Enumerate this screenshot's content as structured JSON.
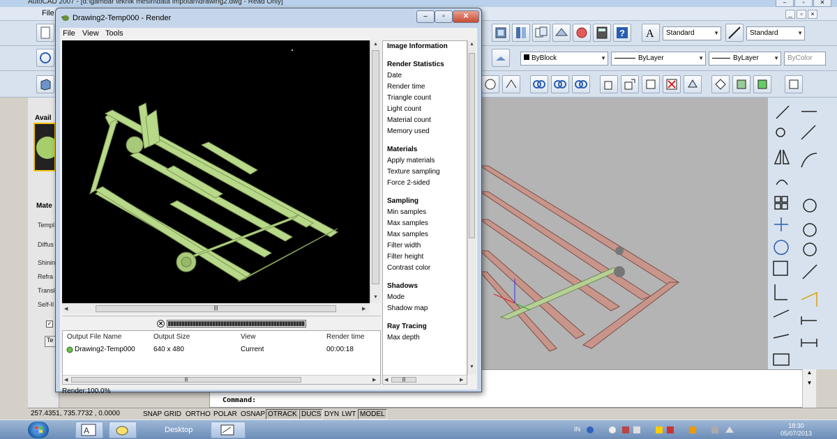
{
  "acad": {
    "title": "AutoCAD 2007 - [d:\\gambar teknik mesin\\data impotan\\drawing2.dwg - Read Only]",
    "menu_file": "File",
    "text_style": "Standard",
    "dim_style": "Standard",
    "color_combo": "ByBlock",
    "linetype_combo": "ByLayer",
    "lineweight_combo": "ByLayer",
    "plotstyle_combo": "ByColor",
    "palette_tab": "Avail",
    "palette_section": "Mate",
    "palette_labels": [
      "Templ",
      "Diffus",
      "Shinin",
      "Refra",
      "Transl",
      "Self-Il"
    ],
    "palette_btn": "Te",
    "command_label": "Command:",
    "coords": "257.4351, 735.7732 , 0.0000",
    "status_toggles": [
      {
        "label": "SNAP",
        "on": false
      },
      {
        "label": "GRID",
        "on": false
      },
      {
        "label": "ORTHO",
        "on": false
      },
      {
        "label": "POLAR",
        "on": false
      },
      {
        "label": "OSNAP",
        "on": false
      },
      {
        "label": "OTRACK",
        "on": true
      },
      {
        "label": "DUCS",
        "on": true
      },
      {
        "label": "DYN",
        "on": false
      },
      {
        "label": "LWT",
        "on": false
      },
      {
        "label": "MODEL",
        "on": true
      }
    ]
  },
  "render_window": {
    "title": "Drawing2-Temp000 - Render",
    "menu": [
      "File",
      "View",
      "Tools"
    ],
    "history_headers": [
      "Output File Name",
      "Output Size",
      "View",
      "Render time"
    ],
    "history_row": {
      "name": "Drawing2-Temp000",
      "size": "640 x 480",
      "view": "Current",
      "time": "00:00:18"
    },
    "progress": 1.0,
    "status": "Render:100.0%",
    "info": [
      {
        "kind": "h",
        "text": "Image Information"
      },
      {
        "kind": "h",
        "text": "Render Statistics"
      },
      {
        "kind": "i",
        "text": "Date"
      },
      {
        "kind": "i",
        "text": "Render time"
      },
      {
        "kind": "i",
        "text": "Triangle count"
      },
      {
        "kind": "i",
        "text": "Light count"
      },
      {
        "kind": "i",
        "text": "Material count"
      },
      {
        "kind": "i",
        "text": "Memory used"
      },
      {
        "kind": "h",
        "text": "Materials"
      },
      {
        "kind": "i",
        "text": "Apply materials"
      },
      {
        "kind": "i",
        "text": "Texture sampling"
      },
      {
        "kind": "i",
        "text": "Force 2-sided"
      },
      {
        "kind": "h",
        "text": "Sampling"
      },
      {
        "kind": "i",
        "text": "Min samples"
      },
      {
        "kind": "i",
        "text": "Max samples"
      },
      {
        "kind": "i",
        "text": "Max samples"
      },
      {
        "kind": "i",
        "text": "Filter width"
      },
      {
        "kind": "i",
        "text": "Filter height"
      },
      {
        "kind": "i",
        "text": "Contrast color"
      },
      {
        "kind": "h",
        "text": "Shadows"
      },
      {
        "kind": "i",
        "text": "Mode"
      },
      {
        "kind": "i",
        "text": "Shadow map"
      },
      {
        "kind": "h",
        "text": "Ray Tracing"
      },
      {
        "kind": "i",
        "text": "Max depth"
      }
    ]
  },
  "taskbar": {
    "desktop_label": "Desktop",
    "lang": "IN",
    "time": "18:30",
    "date": "05/07/2013"
  },
  "colors": {
    "model_green": "#b9d98a",
    "viewport_frame": "#c89088"
  }
}
